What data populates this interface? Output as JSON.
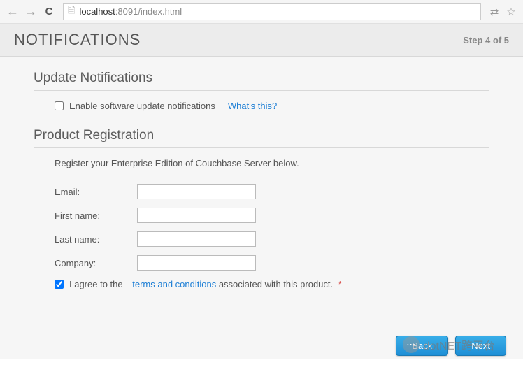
{
  "browser": {
    "url_host": "localhost",
    "url_port": ":8091",
    "url_path": "/index.html"
  },
  "header": {
    "title": "NOTIFICATIONS",
    "step": "Step 4 of 5"
  },
  "sections": {
    "update": {
      "title": "Update Notifications",
      "checkbox_label": "Enable software update notifications",
      "checkbox_checked": false,
      "help_link": "What's this?"
    },
    "registration": {
      "title": "Product Registration",
      "description": "Register your Enterprise Edition of Couchbase Server below.",
      "fields": {
        "email": {
          "label": "Email:",
          "value": ""
        },
        "first_name": {
          "label": "First name:",
          "value": ""
        },
        "last_name": {
          "label": "Last name:",
          "value": ""
        },
        "company": {
          "label": "Company:",
          "value": ""
        }
      },
      "terms": {
        "checked": true,
        "prefix": "I agree to the",
        "link": "terms and conditions",
        "suffix": "associated with this product.",
        "required": "*"
      }
    }
  },
  "buttons": {
    "back": "Back",
    "next": "Next"
  },
  "watermark": "dotNET跨平台"
}
